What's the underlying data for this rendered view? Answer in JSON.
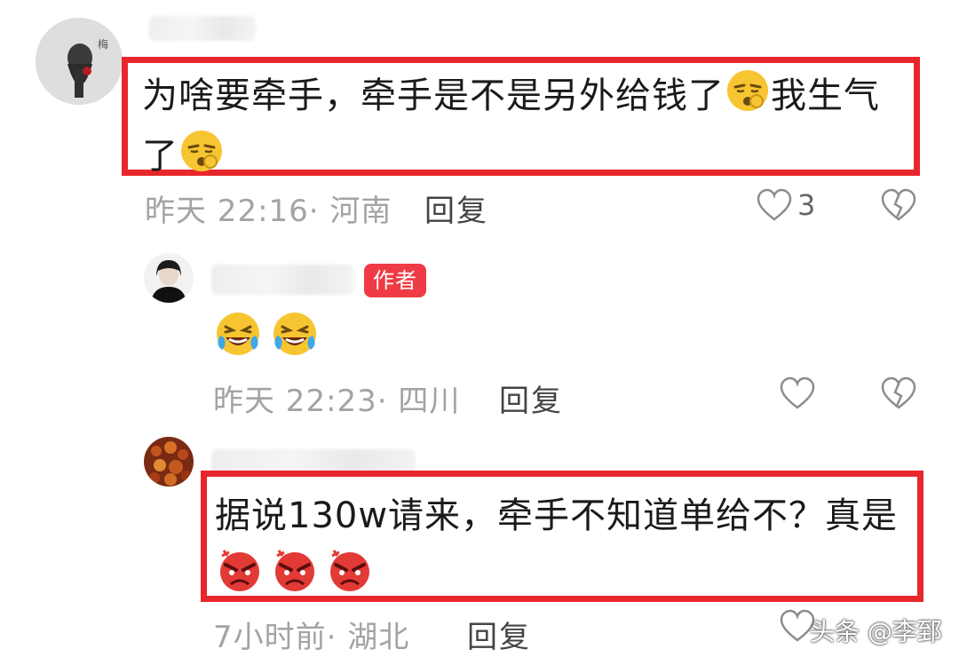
{
  "comments": [
    {
      "text_line1": "为啥要牵手，牵手是不是另外给钱了",
      "text_line1b": "我生气",
      "text_line2": "了",
      "time": "昨天 22:16",
      "location": "河南",
      "reply_label": "回复",
      "like_count": "3"
    },
    {
      "author_badge": "作者",
      "time": "昨天 22:23",
      "location": "四川",
      "reply_label": "回复"
    },
    {
      "text_line1": "据说130w请来，牵手不知道单给不？真是",
      "time": "7小时前",
      "location": "湖北",
      "reply_label": "回复"
    }
  ],
  "watermark": {
    "text": "头条 @李郅"
  },
  "colors": {
    "highlight_box": "#e8272c",
    "author_badge": "#ef3b45",
    "meta_text": "#a3a3a3"
  },
  "icons": [
    "heart-icon",
    "heart-broken-icon",
    "emoji-sulky",
    "emoji-laughing-tears",
    "emoji-angry"
  ]
}
